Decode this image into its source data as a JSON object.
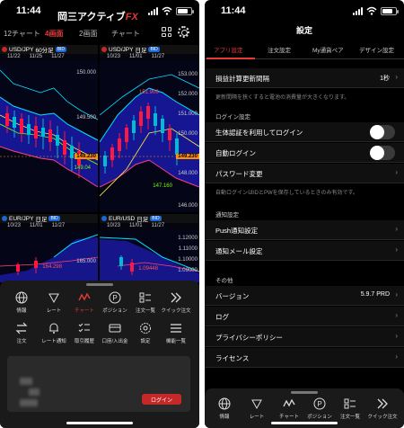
{
  "left": {
    "time": "11:44",
    "tabs": [
      "12チャート",
      "4画面",
      "2画面",
      "チャート"
    ],
    "panels": [
      {
        "pair": "USD/JPY",
        "interval": "60分足",
        "badge": "BID",
        "dates": [
          "11/22",
          "11/25",
          "11/27"
        ],
        "y_ticks": [
          "150.000",
          "149.500",
          "149.000"
        ],
        "price_tag": "149.230",
        "low_label": "149.04"
      },
      {
        "pair": "USD/JPY",
        "interval": "日足",
        "badge": "BID",
        "dates": [
          "10/23",
          "11/01",
          "11/27"
        ],
        "y_ticks": [
          "153.000",
          "152.000",
          "151.000",
          "150.000",
          "149.000",
          "148.000",
          "147.000",
          "146.000"
        ],
        "price_tag": "149.230",
        "high_label": "151.906",
        "low_label": "147.160"
      },
      {
        "pair": "EUR/JPY",
        "interval": "日足",
        "badge": "BID",
        "dates": [
          "10/23",
          "11/01",
          "11/27"
        ],
        "y_ticks": [
          "165.000"
        ],
        "price_tag": "",
        "high_label": "164.298",
        "low_label": ""
      },
      {
        "pair": "EUR/USD",
        "interval": "日足",
        "badge": "BID",
        "dates": [
          "10/23",
          "11/01",
          "11/27"
        ],
        "y_ticks": [
          "1.12000",
          "1.11000",
          "1.10000",
          "1.09000"
        ],
        "price_tag": "",
        "high_label": "1.09448",
        "low_label": ""
      }
    ],
    "menu_row1": [
      "情報",
      "レート",
      "チャート",
      "ポジション",
      "注文一覧",
      "クイック注文"
    ],
    "menu_row2": [
      "注文",
      "レート通知",
      "取引履歴",
      "口座/入出金",
      "設定",
      "機能一覧"
    ],
    "login": {
      "brand_main": "岡三アクティブ",
      "brand_fx": "FX",
      "button": "ログイン"
    }
  },
  "right": {
    "time": "11:44",
    "header": "設定",
    "tabs": [
      "アプリ設定",
      "注文設定",
      "My通貨ペア",
      "デザイン設定"
    ],
    "rows": {
      "refresh": {
        "label": "損益計算更新間隔",
        "value": "1秒"
      },
      "refresh_note": "更新間隔を狭くすると電池の消費量が大きくなります。",
      "login_section": "ログイン設定",
      "biometric": "生体認証を利用してログイン",
      "auto_login": "自動ログイン",
      "password": "パスワード変更",
      "auto_note": "自動ログインはIDとPWを保存しているときのみ有効です。",
      "notify_section": "通知設定",
      "push": "Push通知設定",
      "mail": "通知メール設定",
      "other_section": "その他",
      "version": {
        "label": "バージョン",
        "value": "5.9.7 PRD"
      },
      "log": "ログ",
      "privacy": "プライバシーポリシー",
      "license": "ライセンス"
    },
    "nav": [
      "情報",
      "レート",
      "チャート",
      "ポジション",
      "注文一覧",
      "クイック注文"
    ]
  },
  "colors": {
    "accent": "#e53935",
    "background": "#000000",
    "panel": "#1a1a1a",
    "price_tag": "#ff8f00"
  }
}
